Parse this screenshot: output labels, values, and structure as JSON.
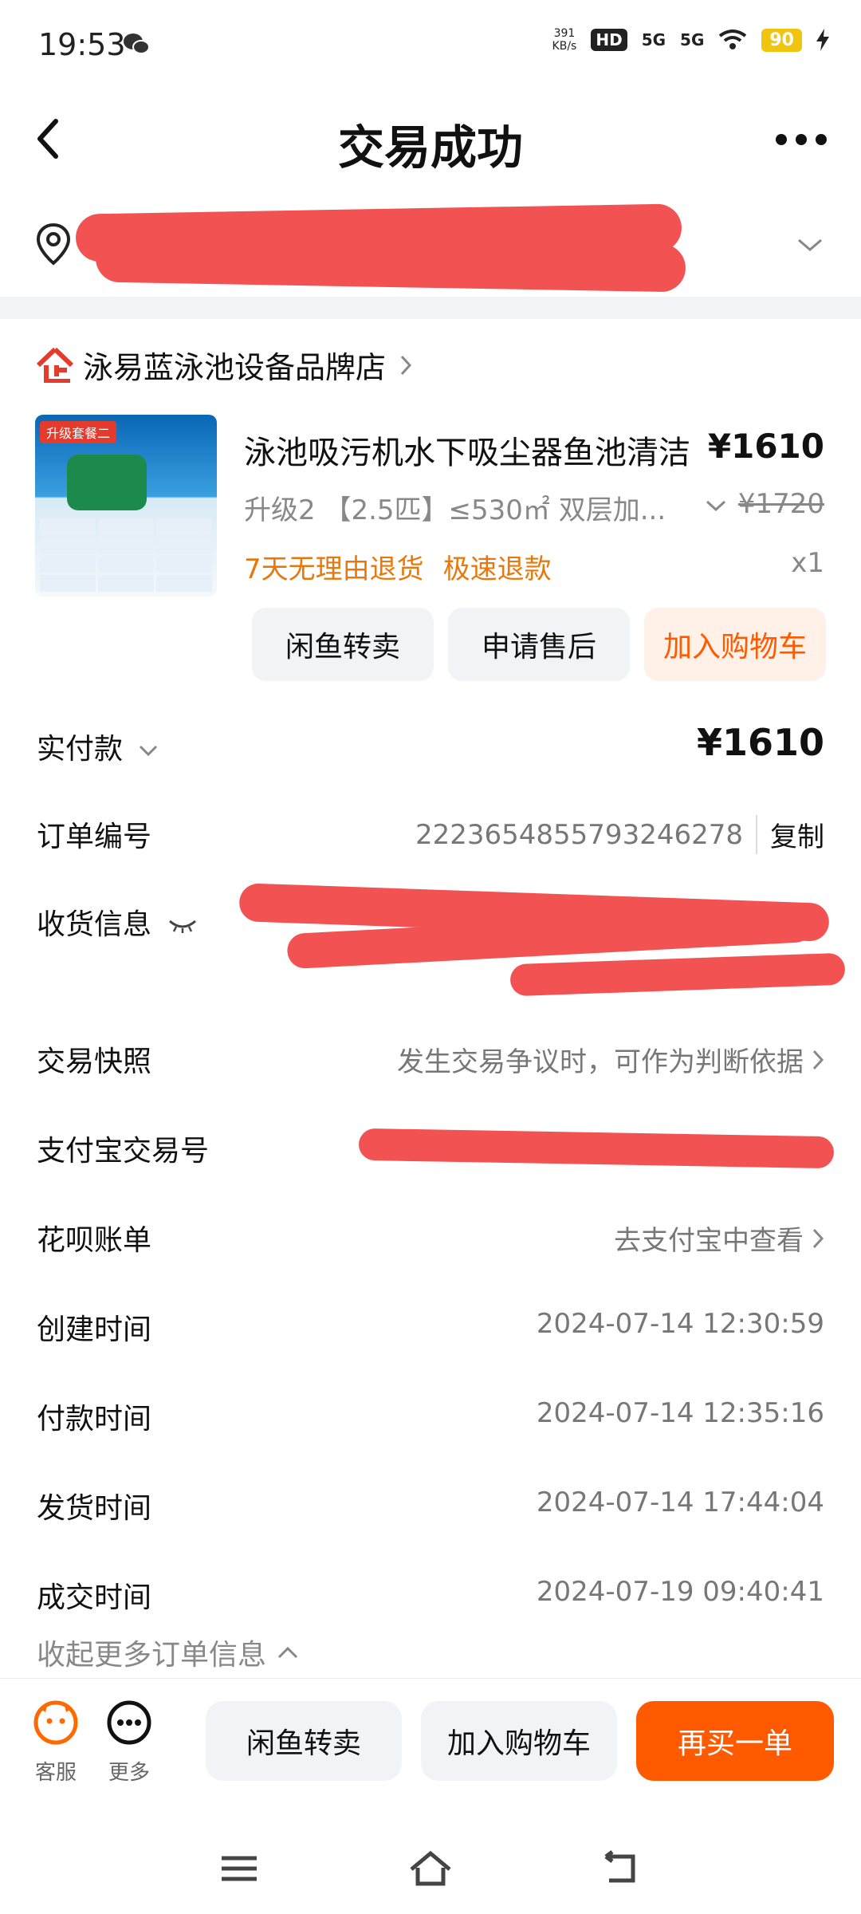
{
  "status": {
    "time": "19:53",
    "net_speed": "391",
    "net_unit": "KB/s",
    "hd": "HD",
    "sig1": "5G",
    "sig2": "5G",
    "battery": "90"
  },
  "header": {
    "title": "交易成功"
  },
  "shop": {
    "name": "泳易蓝泳池设备品牌店"
  },
  "product": {
    "badge": "升级套餐二",
    "title": "泳池吸污机水下吸尘器鱼池清洁",
    "price": "¥1610",
    "spec": "升级2 【2.5匹】≤530㎡ 双层加...",
    "old_price": "¥1720",
    "tag1": "7天无理由退货",
    "tag2": "极速退款",
    "qty": "x1",
    "buttons": [
      "闲鱼转卖",
      "申请售后",
      "加入购物车"
    ]
  },
  "order": {
    "paid_label": "实付款",
    "paid_value": "¥1610",
    "order_no_label": "订单编号",
    "order_no": "2223654855793246278",
    "copy": "复制",
    "shipping_label": "收货信息",
    "snapshot_label": "交易快照",
    "snapshot_value": "发生交易争议时，可作为判断依据",
    "alipay_label": "支付宝交易号",
    "huabei_label": "花呗账单",
    "huabei_value": "去支付宝中查看",
    "created_label": "创建时间",
    "created_value": "2024-07-14 12:30:59",
    "paid_time_label": "付款时间",
    "paid_time_value": "2024-07-14 12:35:16",
    "shipped_label": "发货时间",
    "shipped_value": "2024-07-14 17:44:04",
    "deal_label": "成交时间",
    "deal_value": "2024-07-19 09:40:41",
    "collapse": "收起更多订单信息"
  },
  "bottom": {
    "service": "客服",
    "more": "更多",
    "resell": "闲鱼转卖",
    "cart": "加入购物车",
    "rebuy": "再买一单"
  },
  "colors": {
    "accent": "#ff5a00",
    "tag": "#e8780c",
    "redaction": "#f25252"
  }
}
